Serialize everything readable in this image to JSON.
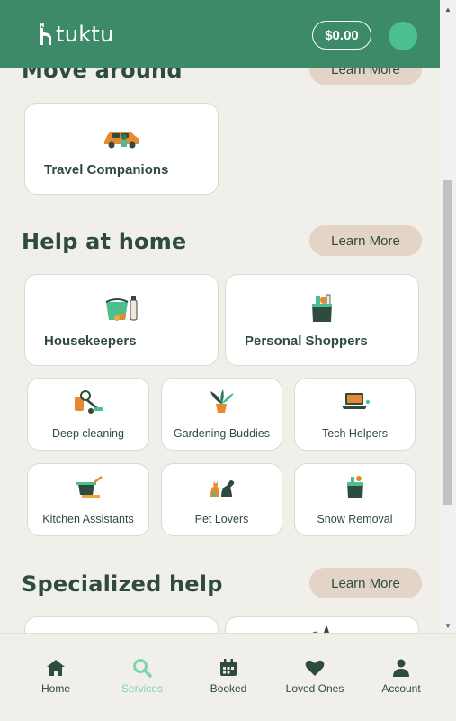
{
  "header": {
    "logo_text": "tuktu",
    "balance": "$0.00"
  },
  "sections": {
    "move_around": {
      "title": "Move around",
      "learn_more": "Learn More",
      "cards": [
        {
          "label": "Travel Companions",
          "icon": "car-icon"
        }
      ]
    },
    "help_at_home": {
      "title": "Help at home",
      "learn_more": "Learn More",
      "big_cards": [
        {
          "label": "Housekeepers",
          "icon": "cleaning-bucket-icon"
        },
        {
          "label": "Personal Shoppers",
          "icon": "grocery-bag-icon"
        }
      ],
      "small_cards": [
        {
          "label": "Deep cleaning",
          "icon": "vacuum-icon"
        },
        {
          "label": "Gardening Buddies",
          "icon": "plant-icon"
        },
        {
          "label": "Tech Helpers",
          "icon": "laptop-icon"
        },
        {
          "label": "Kitchen Assistants",
          "icon": "cooking-pot-icon"
        },
        {
          "label": "Pet Lovers",
          "icon": "pets-icon"
        },
        {
          "label": "Snow Removal",
          "icon": "snow-bag-icon"
        }
      ]
    },
    "specialized_help": {
      "title": "Specialized help",
      "learn_more": "Learn More"
    }
  },
  "nav": {
    "items": [
      {
        "label": "Home",
        "icon": "home-icon"
      },
      {
        "label": "Services",
        "icon": "search-icon",
        "active": true
      },
      {
        "label": "Booked",
        "icon": "calendar-icon"
      },
      {
        "label": "Loved Ones",
        "icon": "heart-icon"
      },
      {
        "label": "Account",
        "icon": "person-icon"
      }
    ]
  },
  "colors": {
    "header": "#3d8a68",
    "accent": "#4bbf8e",
    "text": "#2f4a3f",
    "button": "#e4d3c7",
    "background": "#f1efe9"
  }
}
